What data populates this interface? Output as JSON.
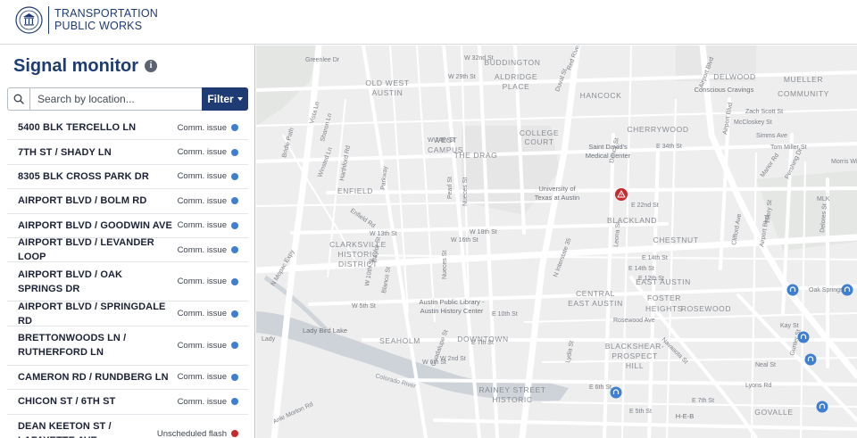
{
  "header": {
    "brand_line1": "TRANSPORTATION",
    "brand_line2": "PUBLIC WORKS",
    "seal_icon": "city-seal-icon"
  },
  "sidebar": {
    "title": "Signal monitor",
    "info_icon_glyph": "i",
    "search": {
      "placeholder": "Search by location..."
    },
    "filter_label": "Filter",
    "status_colors": {
      "Comm. issue": "#3f7fd1",
      "Unscheduled flash": "#c8282e"
    },
    "signals": [
      {
        "location": "5400 BLK TERCELLO LN",
        "status": "Comm. issue"
      },
      {
        "location": "7TH ST / SHADY LN",
        "status": "Comm. issue"
      },
      {
        "location": "8305 BLK CROSS PARK DR",
        "status": "Comm. issue"
      },
      {
        "location": "AIRPORT BLVD / BOLM RD",
        "status": "Comm. issue"
      },
      {
        "location": "AIRPORT BLVD / GOODWIN AVE",
        "status": "Comm. issue"
      },
      {
        "location": "AIRPORT BLVD / LEVANDER LOOP",
        "status": "Comm. issue"
      },
      {
        "location": "AIRPORT BLVD / OAK SPRINGS DR",
        "status": "Comm. issue"
      },
      {
        "location": "AIRPORT BLVD / SPRINGDALE RD",
        "status": "Comm. issue"
      },
      {
        "location": "BRETTONWOODS LN / RUTHERFORD LN",
        "status": "Comm. issue"
      },
      {
        "location": "CAMERON RD / RUNDBERG LN",
        "status": "Comm. issue"
      },
      {
        "location": "CHICON ST / 6TH ST",
        "status": "Comm. issue"
      },
      {
        "location": "DEAN KEETON ST / LAFAYETTE AVE",
        "status": "Unscheduled flash"
      }
    ]
  },
  "map": {
    "zoom_controls": "none",
    "marker_colors": {
      "comm_issue": "#3f7fd1",
      "flash": "#c8282e"
    },
    "neighborhood_labels": [
      "BUDDINGTON",
      "ALDRIDGE PLACE",
      "HANCOCK",
      "OLD WEST AUSTIN",
      "COLLEGE COURT",
      "CHERRYWOOD",
      "MUELLER COMMUNITY",
      "DELWOOD",
      "WEST CAMPUS",
      "THE DRAG",
      "ENFIELD",
      "BLACKLAND",
      "CHESTNUT",
      "CLARKSVILLE HISTORIC DISTRICT",
      "CENTRAL EAST AUSTIN",
      "FOSTER HEIGHTS",
      "ROSEWOOD",
      "EAST AUSTIN",
      "SEAHOLM",
      "DOWNTOWN",
      "BLACKSHEAR-PROSPECT HILL",
      "RAINEY STREET HISTORIC",
      "GOVALLE"
    ],
    "street_labels": [
      "Greenlee Dr",
      "W 32nd St",
      "W 29th St",
      "Airport Blvd",
      "Conscious Cravings",
      "Zach Scott St",
      "McCloskey St",
      "Simms Ave",
      "Tom Miller St",
      "Manor Rd",
      "Morris Wi",
      "E 34th St",
      "Saint David's Medical Center",
      "Dancy St",
      "W 24th St",
      "University of Texas at Austin",
      "E 22nd St",
      "MLK",
      "Harthford Rd",
      "Enfield Rd",
      "W 16th St",
      "W 13th St",
      "W 12th St",
      "E 14th St",
      "E 12th St",
      "N Mopac Expy",
      "Austin Public Library - Austin History Center",
      "E 10th St",
      "W 5th St",
      "E 7th St",
      "Lady Bird Lake",
      "Colorado River",
      "W 6th St",
      "W 2nd St",
      "Airport Blvd",
      "Springdale Rd",
      "Rosewood Ave",
      "Gunter St",
      "Lyons Rd",
      "Neal St",
      "E 6th St",
      "E 5th St",
      "H-E-B",
      "Navasota St",
      "Lydia St",
      "Chicon St",
      "Oak Springs Dr",
      "Kay St",
      "Nueces St",
      "Guadalupe St",
      "Pearl St",
      "San Antonio St",
      "N Interstate 35",
      "Leona St",
      "Clifford Ave",
      "Tillery St",
      "Delores St",
      "Pershing Dr",
      "Alexander Ave",
      "Vista Ln",
      "Sharon Ln",
      "Bridle Path",
      "Winsted Ln",
      "Parkway",
      "Blanco St",
      "Baylor St",
      "Lamar Blvd",
      "Anle Morton Rd",
      "Navasota St"
    ],
    "street_labels_note": "street names as drawn on basemap"
  }
}
